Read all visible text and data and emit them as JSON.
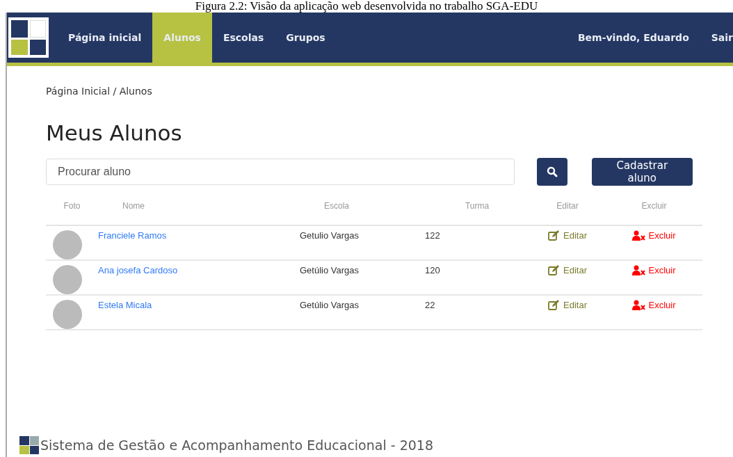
{
  "caption": "Figura 2.2: Visão da aplicação web desenvolvida no trabalho SGA-EDU",
  "nav": {
    "items": [
      {
        "label": "Página inicial",
        "selected": false
      },
      {
        "label": "Alunos",
        "selected": true
      },
      {
        "label": "Escolas",
        "selected": false
      },
      {
        "label": "Grupos",
        "selected": false
      }
    ],
    "welcome": "Bem-vindo, Eduardo",
    "logout": "Sair"
  },
  "breadcrumb": "Página Inicial / Alunos",
  "title": "Meus Alunos",
  "search": {
    "placeholder": "Procurar aluno"
  },
  "register_button": "Cadastrar aluno",
  "table": {
    "columns": [
      "Foto",
      "Nome",
      "Escola",
      "Turma",
      "Editar",
      "Excluir"
    ],
    "rows": [
      {
        "nome": "Franciele Ramos",
        "escola": "Getulio Vargas",
        "turma": "122",
        "editar": "Editar",
        "excluir": "Excluir"
      },
      {
        "nome": "Ana josefa Cardoso",
        "escola": "Getúlio Vargas",
        "turma": "120",
        "editar": "Editar",
        "excluir": "Excluir"
      },
      {
        "nome": "Estela Micala",
        "escola": "Getúlio Vargas",
        "turma": "22",
        "editar": "Editar",
        "excluir": "Excluir"
      }
    ]
  },
  "footer": "Sistema de Gestão e Acompanhamento Educacional - 2018"
}
